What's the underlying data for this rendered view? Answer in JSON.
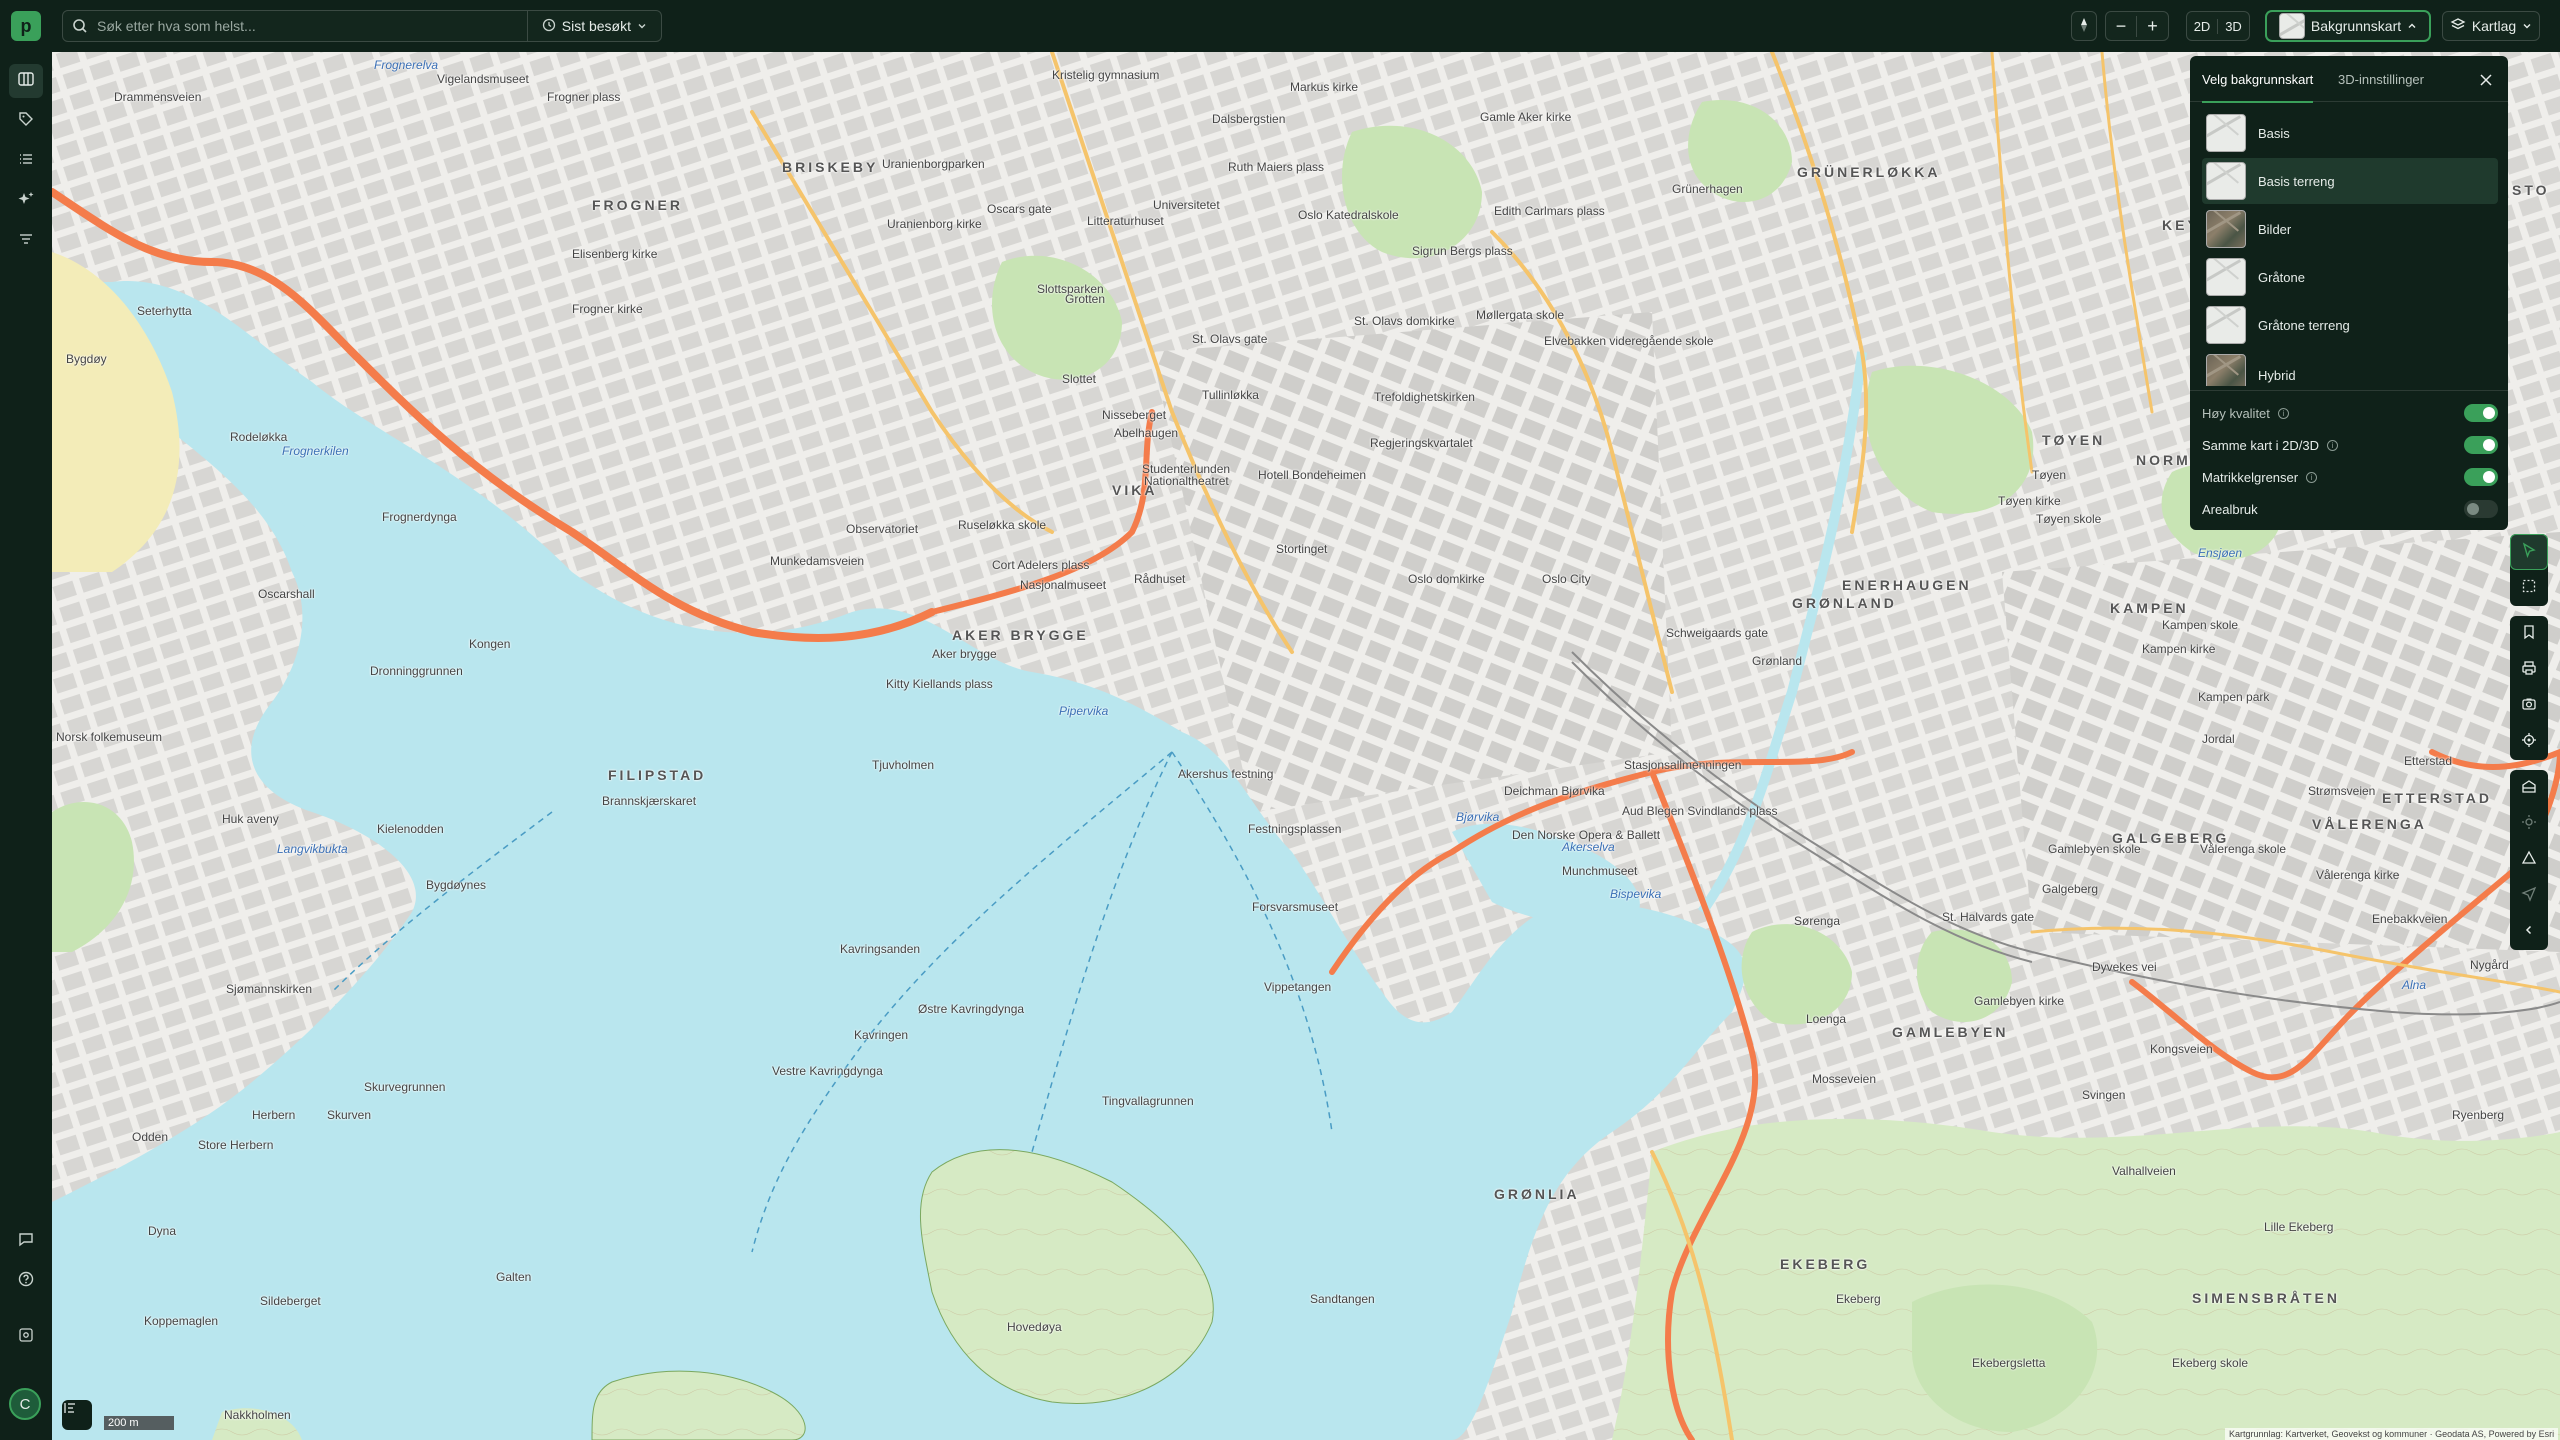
{
  "app": {
    "logo_letter": "p"
  },
  "search": {
    "placeholder": "Søk etter hva som helst...",
    "recent_label": "Sist besøkt"
  },
  "toolbar": {
    "view_2d": "2D",
    "view_3d": "3D",
    "background_button": "Bakgrunnskart",
    "layers_button": "Kartlag"
  },
  "panel": {
    "tab_background": "Velg bakgrunnskart",
    "tab_3d": "3D-innstillinger",
    "maps": [
      {
        "label": "Basis",
        "selected": false
      },
      {
        "label": "Basis terreng",
        "selected": true
      },
      {
        "label": "Bilder",
        "selected": false
      },
      {
        "label": "Gråtone",
        "selected": false
      },
      {
        "label": "Gråtone terreng",
        "selected": false
      },
      {
        "label": "Hybrid",
        "selected": false
      }
    ],
    "toggles": [
      {
        "label": "Høy kvalitet",
        "on": true
      },
      {
        "label": "Samme kart i 2D/3D",
        "on": true
      },
      {
        "label": "Matrikkelgrenser",
        "on": true
      },
      {
        "label": "Arealbruk",
        "on": false
      }
    ]
  },
  "user": {
    "initial": "C"
  },
  "map": {
    "scale": "200 m",
    "attribution": "Kartgrunnlag: Kartverket, Geovekst og kommuner · Geodata AS, Powered by Esri",
    "districts": [
      "FROGNER",
      "BRISKEBY",
      "GRÜNERLØKKA",
      "VIKA",
      "AKER BRYGGE",
      "FILIPSTAD",
      "GRØNLAND",
      "ENERHAUGEN",
      "TØYEN",
      "KAMPEN",
      "VÅLERENGA",
      "GALGEBERG",
      "ETTERSTAD",
      "GAMLEBYEN",
      "EKEBERG",
      "GRØNLIA",
      "SIMENSBRÅTEN",
      "KEY",
      "NORM",
      "STO"
    ],
    "places": [
      "Frognerelva",
      "Vigelandsmuseet",
      "Frogner plass",
      "Elisenberg kirke",
      "Frogner kirke",
      "Uranienborgparken",
      "Uranienborg kirke",
      "Oscars gate",
      "Slottsparken",
      "Slottet",
      "Grotten",
      "Drammensveien",
      "Seterhytta",
      "Rodeløkka",
      "Frognerkilen",
      "Frognerdynga",
      "Oscarshall",
      "Dronninggrunnen",
      "Bygdøy",
      "Kongen",
      "Kielenodden",
      "Bygdøynes",
      "Langvikbukta",
      "Sjømannskirken",
      "Herbern",
      "Skurvegrunnen",
      "Skurven",
      "Store Herbern",
      "Odden",
      "Dyna",
      "Galten",
      "Sildeberget",
      "Koppemaglen",
      "Nakkholmen",
      "Norsk folkemuseum",
      "Huk aveny",
      "Aker brygge",
      "Kitty Kiellands plass",
      "Tjuvholmen",
      "Brannskjærskaret",
      "Pipervika",
      "Akershus festning",
      "Festningsplassen",
      "Forsvarsmuseet",
      "Vippetangen",
      "Kavringsanden",
      "Kavringen",
      "Østre Kavringdynga",
      "Vestre Kavringdynga",
      "Tingvallagrunnen",
      "Hovedøya",
      "Sandtangen",
      "Bjørvika",
      "Akerselva",
      "Bispevika",
      "Munchmuseet",
      "Den Norske Opera & Ballett",
      "Deichman Bjørvika",
      "Stasjonsallmenningen",
      "Aud Blegen Svindlands plass",
      "Oslo City",
      "Oslo domkirke",
      "Stortinget",
      "Rådhuset",
      "Nasjonalmuseet",
      "Cort Adelers plass",
      "Ruseløkka skole",
      "Observatoriet",
      "Munkedamsveien",
      "Nisseberget",
      "Abelhaugen",
      "Studenterlunden",
      "Nationaltheatret",
      "Hotell Bondeheimen",
      "Regjeringskvartalet",
      "Trefoldighetskirken",
      "St. Olavs domkirke",
      "St. Olavs gate",
      "Tullinløkka",
      "Litteraturhuset",
      "Universitetet",
      "Ruth Maiers plass",
      "Oslo Katedralskole",
      "Sigrun Bergs plass",
      "Gamle Aker kirke",
      "Markus kirke",
      "Dalsbergstien",
      "Kristelig gymnasium",
      "Edith Carlmars plass",
      "Grünerhagen",
      "Møllergata skole",
      "Elvebakken videregående skole",
      "Schweigaards gate",
      "Grønland",
      "Tøyen",
      "Tøyen skole",
      "Tøyen kirke",
      "Kampen skole",
      "Kampen kirke",
      "Kampen park",
      "Vålerenga skole",
      "Vålerenga kirke",
      "Galgeberg",
      "Etterstad",
      "Strømsveien",
      "Gamlebyen skole",
      "St. Halvards gate",
      "Gamlebyen kirke",
      "Sørenga",
      "Loenga",
      "Mosseveien",
      "Ekeberg",
      "Ekebergsletta",
      "Ekeberg skole",
      "Ryenberg",
      "Svingen",
      "Valhallveien",
      "Enebakkveien",
      "Nygård",
      "Alna",
      "Jordal",
      "Ensjøen",
      "Lille Ekeberg",
      "Kongsveien",
      "Dyvekes vei"
    ]
  },
  "colors": {
    "chrome": "#0f2119",
    "accent": "#3aa05a",
    "water": "#b9e6ee",
    "park": "#c8e4b4",
    "road": "#f47c4b",
    "road_minor": "#f5c46b"
  }
}
